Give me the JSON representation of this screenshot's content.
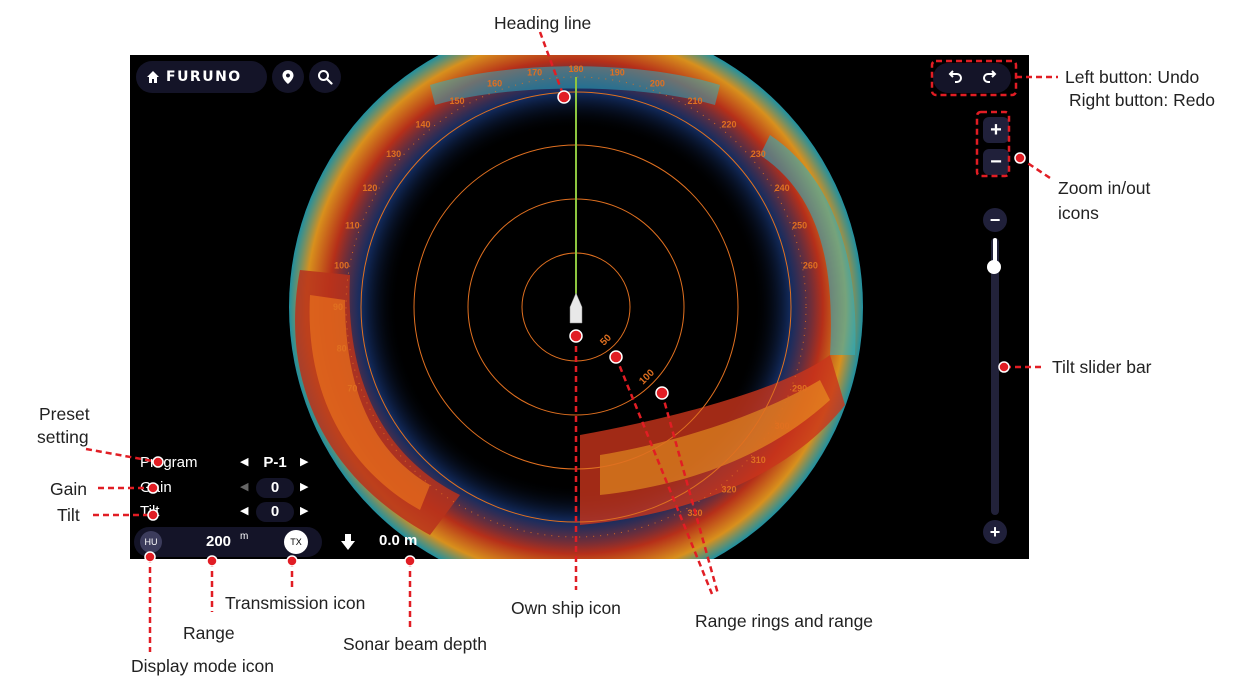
{
  "toolbar": {
    "brand": "FURUNO"
  },
  "sonar": {
    "range_ring_labels": [
      "50",
      "100"
    ],
    "bearing_labels": [
      "70",
      "80",
      "90",
      "100",
      "110",
      "120",
      "130",
      "140",
      "150",
      "160",
      "170",
      "180",
      "190",
      "200",
      "210",
      "220",
      "230",
      "240",
      "250",
      "260",
      "290",
      "300",
      "310",
      "320",
      "330"
    ]
  },
  "params": {
    "program": {
      "label": "Program",
      "value": "P-1"
    },
    "gain": {
      "label": "Gain",
      "value": "0"
    },
    "tilt": {
      "label": "Tilt",
      "value": "0"
    }
  },
  "status_bar": {
    "mode": "HU",
    "range_value": "200",
    "range_unit": "m",
    "tx": "TX"
  },
  "depth": {
    "value": "0.0 m"
  },
  "controls": {
    "zoom_in": "+",
    "zoom_out": "−",
    "tilt_minus": "−",
    "tilt_plus": "+"
  },
  "callouts": {
    "heading_line": "Heading line",
    "undo_redo_1": "Left button: Undo",
    "undo_redo_2": "Right button: Redo",
    "zoom_1": "Zoom in/out",
    "zoom_2": "icons",
    "tilt_slider": "Tilt slider bar",
    "preset_1": "Preset",
    "preset_2": "setting",
    "gain": "Gain",
    "tilt": "Tilt",
    "transmission": "Transmission icon",
    "range": "Range",
    "display_mode": "Display mode icon",
    "own_ship": "Own ship icon",
    "sonar_depth": "Sonar beam depth",
    "range_rings": "Range rings and range"
  },
  "colors": {
    "heading": "#8dc63f",
    "rings": "#e07020",
    "callout": "#e11d24",
    "panel": "#141428"
  }
}
